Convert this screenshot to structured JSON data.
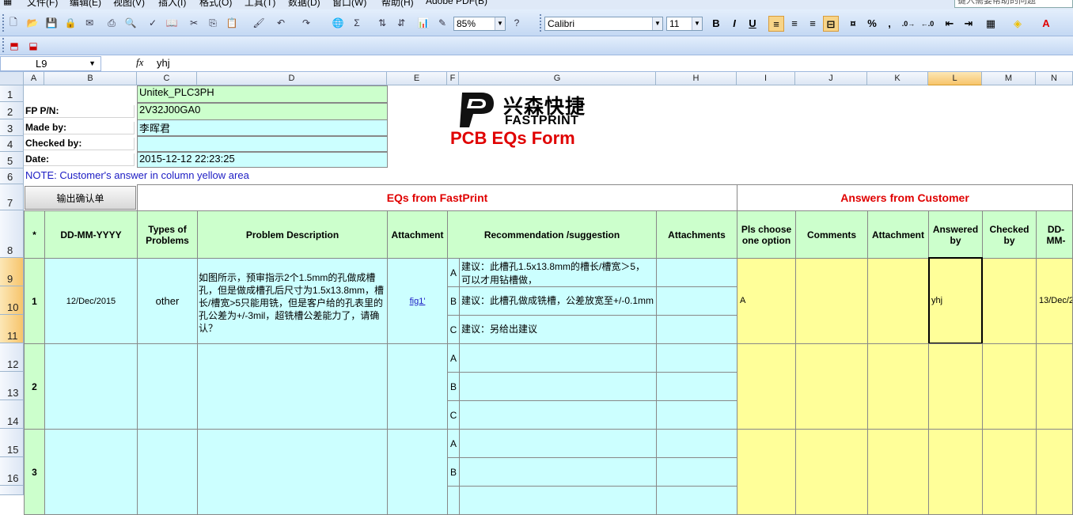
{
  "menu": {
    "items": [
      "文件(F)",
      "编辑(E)",
      "视图(V)",
      "插入(I)",
      "格式(O)",
      "工具(T)",
      "数据(D)",
      "窗口(W)",
      "帮助(H)",
      "Adobe PDF(B)"
    ],
    "help_placeholder": "键入需要帮助的问题"
  },
  "toolbar": {
    "zoom": "85%",
    "font": "Calibri",
    "size": "11",
    "bold": "B",
    "italic": "I",
    "underline": "U",
    "sigma": "Σ",
    "percent": "%",
    "comma": ","
  },
  "formula_bar": {
    "name_box": "L9",
    "fx": "fx",
    "value": "yhj"
  },
  "columns": [
    "A",
    "B",
    "C",
    "D",
    "E",
    "F",
    "G",
    "H",
    "I",
    "J",
    "K",
    "L",
    "M",
    "N"
  ],
  "rows": [
    "1",
    "2",
    "3",
    "4",
    "5",
    "6",
    "7",
    "8",
    "9",
    "10",
    "11",
    "12",
    "13",
    "14",
    "15",
    "16"
  ],
  "header": {
    "c1": "Unitek_PLC3PH",
    "fp_label": "FP P/N:",
    "fp_value": "2V32J00GA0",
    "made_label": "Made by:",
    "made_value": "李晖君",
    "checked_label": "Checked by:",
    "checked_value": "",
    "date_label": "Date:",
    "date_value": "2015-12-12 22:23:25",
    "note": "NOTE: Customer's  answer in column yellow area",
    "logo_cn": "兴森快捷",
    "logo_en": "FASTPRINT",
    "form_title": "PCB EQs Form"
  },
  "section": {
    "export_button": "输出确认单",
    "eqs_title": "EQs from FastPrint",
    "answers_title": "Answers from Customer"
  },
  "table_headers": {
    "star": "*",
    "date": "DD-MM-YYYY",
    "types": "Types of Problems",
    "desc": "Problem Description",
    "attachment": "Attachment",
    "recommendation": "Recommendation /suggestion",
    "attachments": "Attachments",
    "choose": "Pls choose one option",
    "comments": "Comments",
    "attachment2": "Attachment",
    "answered": "Answered by",
    "checked": "Checked by",
    "date2": "DD-MM-"
  },
  "eq1": {
    "num": "1",
    "date": "12/Dec/2015",
    "type": "other",
    "desc": "如图所示，预审指示2个1.5mm的孔做成槽孔，但是做成槽孔后尺寸为1.5x13.8mm，槽长/槽宽>5只能用铣，但是客户给的孔表里的孔公差为+/-3mil，超铣槽公差能力了，请确认？",
    "attachment": "fig1'",
    "opt_a": "A",
    "rec_a": "建议：此槽孔1.5x13.8mm的槽长/槽宽＞5，可以才用钻槽做，",
    "opt_b": "B",
    "rec_b": "建议：此槽孔做成铣槽，公差放宽至+/-0.1mm",
    "opt_c": "C",
    "rec_c": "建议：另给出建议",
    "choice": "A",
    "answered_by": "yhj",
    "answer_date": "13/Dec/2"
  },
  "eq2": {
    "num": "2",
    "opt_a": "A",
    "opt_b": "B",
    "opt_c": "C"
  },
  "eq3": {
    "num": "3",
    "opt_a": "A",
    "opt_b": "B"
  }
}
